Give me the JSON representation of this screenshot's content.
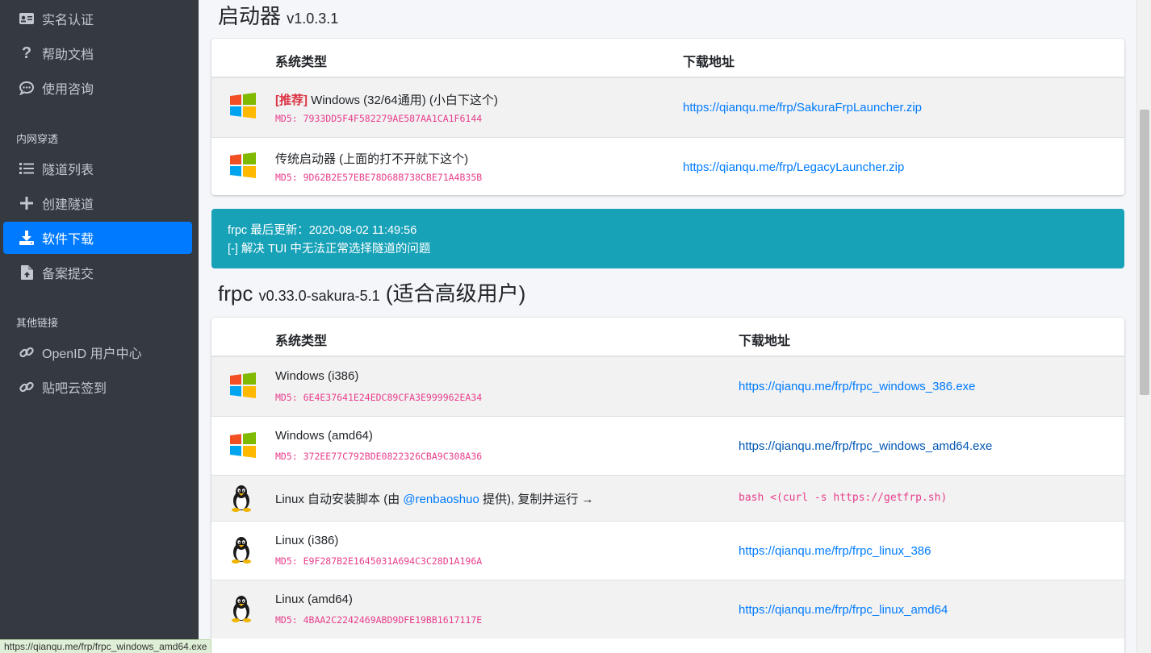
{
  "sidebar": {
    "items_top": [
      {
        "label": "实名认证",
        "icon": "id-card-icon"
      },
      {
        "label": "帮助文档",
        "icon": "question-icon"
      },
      {
        "label": "使用咨询",
        "icon": "chat-icon"
      }
    ],
    "section_tunnel": "内网穿透",
    "items_tunnel": [
      {
        "label": "隧道列表",
        "icon": "list-icon"
      },
      {
        "label": "创建隧道",
        "icon": "plus-icon"
      },
      {
        "label": "软件下载",
        "icon": "download-icon",
        "active": true
      },
      {
        "label": "备案提交",
        "icon": "file-upload-icon"
      }
    ],
    "section_links": "其他链接",
    "items_links": [
      {
        "label": "OpenID 用户中心",
        "icon": "link-icon"
      },
      {
        "label": "贴吧云签到",
        "icon": "link-icon"
      }
    ]
  },
  "launcher": {
    "title": "启动器",
    "version": "v1.0.3.1",
    "col_type": "系统类型",
    "col_url": "下载地址",
    "rows": [
      {
        "badge": "[推荐]",
        "name": " Windows (32/64通用) (小白下这个)",
        "md5": "MD5: 7933DD5F4F582279AE587AA1CA1F6144",
        "url": "https://qianqu.me/frp/SakuraFrpLauncher.zip",
        "icon": "windows-icon"
      },
      {
        "name": "传统启动器 (上面的打不开就下这个)",
        "md5": "MD5: 9D62B2E57EBE78D68B738CBE71A4B35B",
        "url": "https://qianqu.me/frp/LegacyLauncher.zip",
        "icon": "windows-icon"
      }
    ]
  },
  "update_alert": {
    "line1": "frpc 最后更新：2020-08-02 11:49:56",
    "line2": "[-] 解决 TUI 中无法正常选择隧道的问题"
  },
  "frpc": {
    "title_a": "frpc",
    "version": "v0.33.0-sakura-5.1",
    "title_b": "(适合高级用户)",
    "col_type": "系统类型",
    "col_url": "下载地址",
    "rows": [
      {
        "name": "Windows (i386)",
        "md5": "MD5: 6E4E37641E24EDC89CFA3E999962EA34",
        "url": "https://qianqu.me/frp/frpc_windows_386.exe",
        "icon": "windows-icon"
      },
      {
        "name": "Windows (amd64)",
        "md5": "MD5: 372EE77C792BDE0822326CBA9C308A36",
        "url": "https://qianqu.me/frp/frpc_windows_amd64.exe",
        "icon": "windows-icon"
      },
      {
        "name_a": "Linux 自动安装脚本 (由 ",
        "name_link": "@renbaoshuo",
        "name_b": " 提供), 复制并运行 →",
        "code": "bash <(curl -s https://getfrp.sh)",
        "icon": "linux-icon"
      },
      {
        "name": "Linux (i386)",
        "md5": "MD5: E9F287B2E1645031A694C3C28D1A196A",
        "url": "https://qianqu.me/frp/frpc_linux_386",
        "icon": "linux-icon"
      },
      {
        "name": "Linux (amd64)",
        "md5": "MD5: 4BAA2C2242469ABD9DFE19BB1617117E",
        "url": "https://qianqu.me/frp/frpc_linux_amd64",
        "icon": "linux-icon"
      }
    ]
  },
  "status_bar": "https://qianqu.me/frp/frpc_windows_amd64.exe",
  "colors": {
    "sidebar_bg": "#343a40",
    "active": "#007bff",
    "alert": "#17a2b8",
    "md5": "#e83e8c",
    "link": "#007bff"
  }
}
